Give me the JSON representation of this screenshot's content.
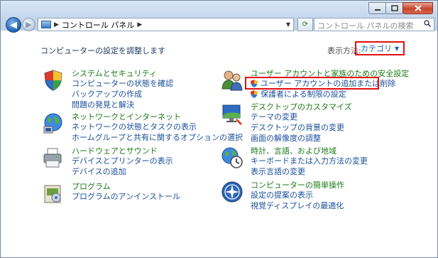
{
  "address": {
    "path": [
      "コントロール パネル"
    ]
  },
  "search": {
    "placeholder": "コントロール パネルの検索"
  },
  "page": {
    "subtitle": "コンピューターの設定を調整します",
    "view_by_label": "表示方法:",
    "view_by_value": "カテゴリ"
  },
  "left_categories": [
    {
      "heading": "システムとセキュリティ",
      "icon": "shield-icon",
      "links": [
        "コンピューターの状態を確認",
        "バックアップの作成",
        "問題の発見と解決"
      ]
    },
    {
      "heading": "ネットワークとインターネット",
      "icon": "network-globe-icon",
      "links": [
        "ネットワークの状態とタスクの表示",
        "ホームグループと共有に関するオプションの選択"
      ]
    },
    {
      "heading": "ハードウェアとサウンド",
      "icon": "printer-icon",
      "links": [
        "デバイスとプリンターの表示",
        "デバイスの追加"
      ]
    },
    {
      "heading": "プログラム",
      "icon": "programs-icon",
      "links": [
        "プログラムのアンインストール"
      ]
    }
  ],
  "right_categories": [
    {
      "heading": "ユーザー アカウントと家族のための安全設定",
      "icon": "users-icon",
      "links": [
        "ユーザー アカウントの追加または削除",
        "保護者による制限の設定"
      ]
    },
    {
      "heading": "デスクトップのカスタマイズ",
      "icon": "desktop-icon",
      "links": [
        "テーマの変更",
        "デスクトップの背景の変更",
        "画面の解像度の調整"
      ]
    },
    {
      "heading": "時計、言語、および地域",
      "icon": "clock-globe-icon",
      "links": [
        "キーボードまたは入力方法の変更",
        "表示言語の変更"
      ]
    },
    {
      "heading": "コンピューターの簡単操作",
      "icon": "ease-of-access-icon",
      "links": [
        "設定の提案の表示",
        "視覚ディスプレイの最適化"
      ]
    }
  ],
  "colors": {
    "heading": "#1b7a17",
    "link": "#1a4e9a",
    "highlight": "#e01010"
  }
}
